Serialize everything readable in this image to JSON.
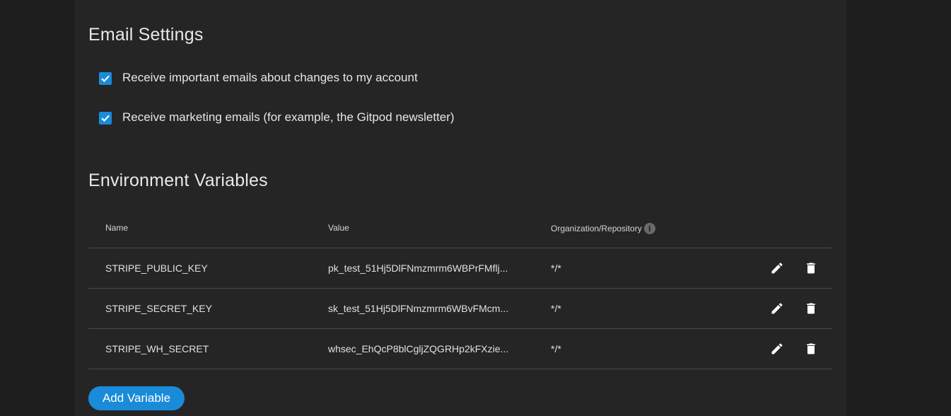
{
  "email_settings": {
    "title": "Email Settings",
    "options": [
      {
        "label": "Receive important emails about changes to my account",
        "checked": true
      },
      {
        "label": "Receive marketing emails (for example, the Gitpod newsletter)",
        "checked": true
      }
    ]
  },
  "env_vars": {
    "title": "Environment Variables",
    "columns": {
      "name": "Name",
      "value": "Value",
      "org": "Organization/Repository",
      "info_icon": "i"
    },
    "rows": [
      {
        "name": "STRIPE_PUBLIC_KEY",
        "value": "pk_test_51Hj5DlFNmzmrm6WBPrFMflj...",
        "org": "*/*"
      },
      {
        "name": "STRIPE_SECRET_KEY",
        "value": "sk_test_51Hj5DlFNmzmrm6WBvFMcm...",
        "org": "*/*"
      },
      {
        "name": "STRIPE_WH_SECRET",
        "value": "whsec_EhQcP8blCgljZQGRHp2kFXzie...",
        "org": "*/*"
      }
    ],
    "row_icons": {
      "edit": "pencil-icon",
      "delete": "trash-icon"
    },
    "add_button_label": "Add Variable"
  },
  "colors": {
    "accent": "#1a8bd8",
    "page_bg": "#1e1e1e",
    "panel_bg": "#252526"
  }
}
